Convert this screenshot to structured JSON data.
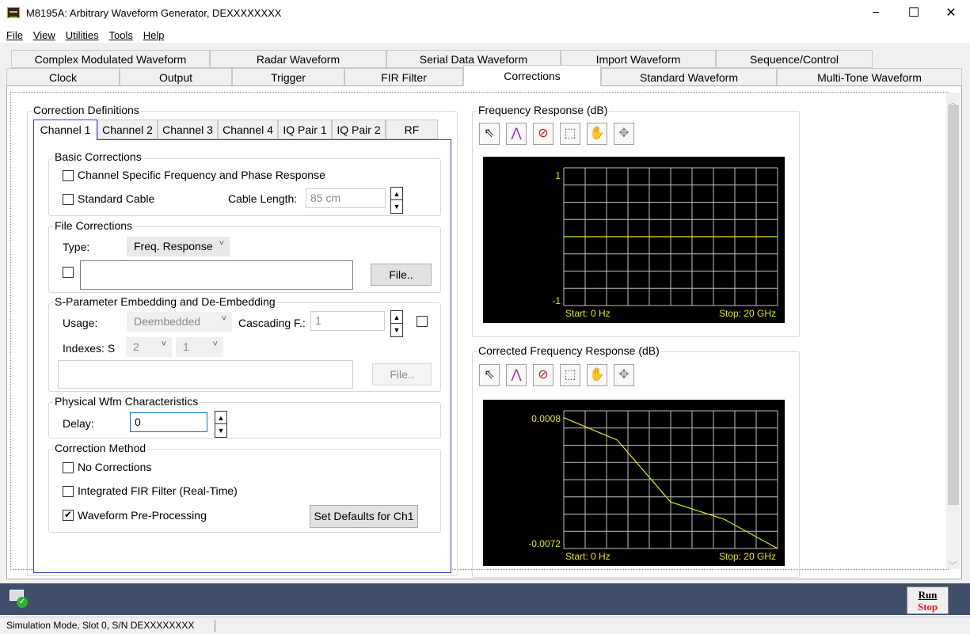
{
  "window": {
    "title": "M8195A: Arbitrary Waveform Generator, DEXXXXXXXX",
    "minimize": "−",
    "maximize": "☐",
    "close": "✕"
  },
  "menu": [
    "File",
    "View",
    "Utilities",
    "Tools",
    "Help"
  ],
  "tabs_row1": [
    "Complex Modulated Waveform",
    "Radar Waveform",
    "Serial Data Waveform",
    "Import Waveform",
    "Sequence/Control"
  ],
  "tabs_row2": [
    "Clock",
    "Output",
    "Trigger",
    "FIR Filter",
    "Corrections",
    "Standard Waveform",
    "Multi-Tone Waveform"
  ],
  "active_tab": "Corrections",
  "correction_definitions": {
    "title": "Correction Definitions",
    "subtabs": [
      "Channel 1",
      "Channel 2",
      "Channel 3",
      "Channel 4",
      "IQ Pair 1",
      "IQ Pair 2",
      "RF"
    ],
    "active_subtab": "Channel 1",
    "basic": {
      "title": "Basic Corrections",
      "channel_specific_label": "Channel Specific Frequency and Phase Response",
      "channel_specific_checked": false,
      "standard_cable_label": "Standard Cable",
      "standard_cable_checked": false,
      "cable_length_label": "Cable Length:",
      "cable_length_value": "85 cm"
    },
    "file": {
      "title": "File Corrections",
      "type_label": "Type:",
      "type_value": "Freq. Response",
      "path_value": "",
      "file_button": "File.."
    },
    "sparam": {
      "title": "S-Parameter Embedding and De-Embedding",
      "usage_label": "Usage:",
      "usage_value": "Deembedded",
      "cascading_label": "Cascading F.:",
      "cascading_value": "1",
      "indexes_label": "Indexes: S",
      "index1": "2",
      "index2": "1",
      "path_value": "",
      "file_button": "File.."
    },
    "physical": {
      "title": "Physical Wfm Characteristics",
      "delay_label": "Delay:",
      "delay_value": "0"
    },
    "method": {
      "title": "Correction Method",
      "no_corrections": "No Corrections",
      "integrated_fir": "Integrated FIR Filter (Real-Time)",
      "preprocessing": "Waveform Pre-Processing",
      "preprocessing_check": "✔",
      "set_defaults": "Set Defaults for Ch1"
    }
  },
  "freq_response": {
    "title": "Frequency Response (dB)",
    "toolbar_icons": [
      "arrow-cursor-icon",
      "peak-marker-icon",
      "no-entry-icon",
      "zoom-rect-icon",
      "pan-hand-icon",
      "move-arrows-icon"
    ],
    "chart_data": {
      "type": "line",
      "ylim": [
        -1,
        1
      ],
      "ytick_top": "1",
      "ytick_bottom": "-1",
      "start_label": "Start: 0 Hz",
      "stop_label": "Stop: 20 GHz",
      "x": [
        0,
        20
      ],
      "series": [
        {
          "values": [
            0,
            0
          ]
        }
      ],
      "grid": true
    }
  },
  "corrected_response": {
    "title": "Corrected Frequency Response (dB)",
    "toolbar_icons": [
      "arrow-cursor-icon",
      "peak-marker-icon",
      "no-entry-icon",
      "zoom-rect-icon",
      "pan-hand-icon",
      "move-arrows-icon"
    ],
    "chart_data": {
      "type": "line",
      "ylim": [
        -0.0072,
        0.0008
      ],
      "ytick_top": "0.0008",
      "ytick_bottom": "-0.0072",
      "start_label": "Start: 0 Hz",
      "stop_label": "Stop: 20 GHz",
      "x": [
        0,
        5,
        10,
        15,
        20
      ],
      "series": [
        {
          "values": [
            0.0004,
            -0.0009,
            -0.0045,
            -0.0055,
            -0.0072
          ]
        }
      ],
      "grid": true
    }
  },
  "run_stop": {
    "run": "Run",
    "stop": "Stop"
  },
  "status": "Simulation Mode, Slot 0, S/N DEXXXXXXXX",
  "colors": {
    "trace": "#e6e600",
    "grid": "#c0c0c0",
    "bottom_bar": "#3f4f6a",
    "active_border": "#3c3cc0"
  }
}
